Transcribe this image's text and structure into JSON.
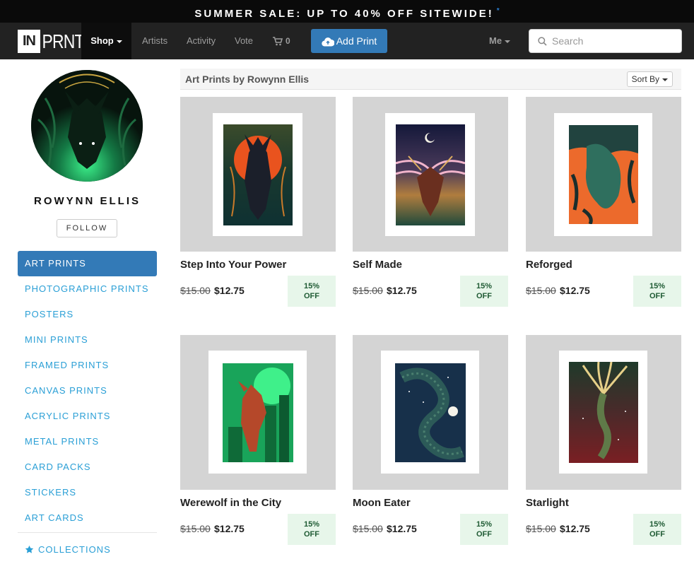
{
  "banner": {
    "text": "SUMMER SALE: UP TO 40% OFF SITEWIDE!",
    "mark": "*"
  },
  "navbar": {
    "logo_in": "IN",
    "logo_prnt": "PRNT",
    "shop": "Shop",
    "artists": "Artists",
    "activity": "Activity",
    "vote": "Vote",
    "cart_count": "0",
    "add_print": "Add Print",
    "me": "Me",
    "search_placeholder": "Search"
  },
  "artist": {
    "name": "ROWYNN ELLIS",
    "follow": "FOLLOW"
  },
  "sidebar": {
    "items": [
      {
        "label": "ART PRINTS",
        "active": true
      },
      {
        "label": "PHOTOGRAPHIC PRINTS"
      },
      {
        "label": "POSTERS"
      },
      {
        "label": "MINI PRINTS"
      },
      {
        "label": "FRAMED PRINTS"
      },
      {
        "label": "CANVAS PRINTS"
      },
      {
        "label": "ACRYLIC PRINTS"
      },
      {
        "label": "METAL PRINTS"
      },
      {
        "label": "CARD PACKS"
      },
      {
        "label": "STICKERS"
      },
      {
        "label": "ART CARDS"
      }
    ],
    "collections": "COLLECTIONS"
  },
  "main": {
    "title": "Art Prints by Rowynn Ellis",
    "sort": "Sort By"
  },
  "products": [
    {
      "title": "Step Into Your Power",
      "old_price": "$15.00",
      "new_price": "$12.75",
      "discount_pct": "15%",
      "discount_off": "OFF"
    },
    {
      "title": "Self Made",
      "old_price": "$15.00",
      "new_price": "$12.75",
      "discount_pct": "15%",
      "discount_off": "OFF"
    },
    {
      "title": "Reforged",
      "old_price": "$15.00",
      "new_price": "$12.75",
      "discount_pct": "15%",
      "discount_off": "OFF"
    },
    {
      "title": "Werewolf in the City",
      "old_price": "$15.00",
      "new_price": "$12.75",
      "discount_pct": "15%",
      "discount_off": "OFF"
    },
    {
      "title": "Moon Eater",
      "old_price": "$15.00",
      "new_price": "$12.75",
      "discount_pct": "15%",
      "discount_off": "OFF"
    },
    {
      "title": "Starlight",
      "old_price": "$15.00",
      "new_price": "$12.75",
      "discount_pct": "15%",
      "discount_off": "OFF"
    }
  ],
  "colors": {
    "accent": "#337ab7",
    "link": "#2a9fd6",
    "badge_bg": "#e7f6ea",
    "badge_text": "#1f5b34",
    "navbar": "#222222"
  }
}
